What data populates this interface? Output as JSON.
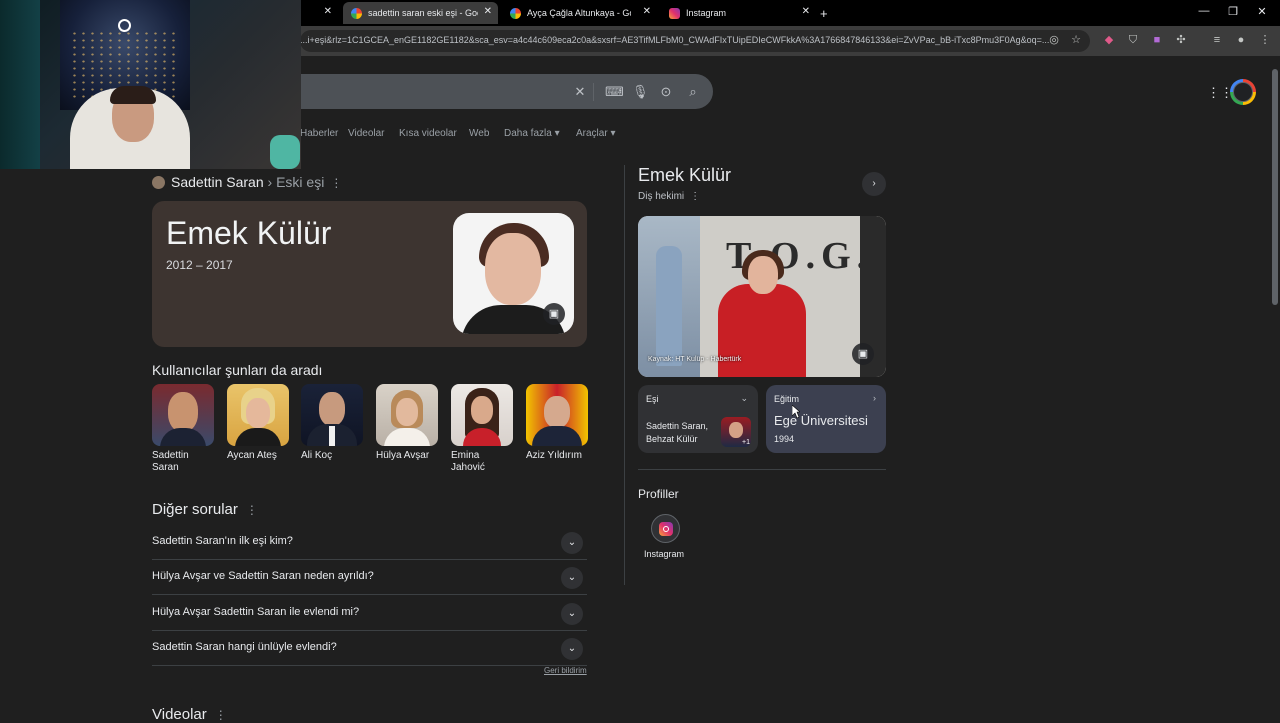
{
  "browser": {
    "tabs": [
      {
        "title": "sadettin saran eski eşi - Google",
        "active": true
      },
      {
        "title": "Ayça Çağla Altunkaya - Google",
        "active": false
      },
      {
        "title": "Instagram",
        "active": false
      }
    ],
    "url": "...i+eşi&rlz=1C1GCEA_enGE1182GE1182&sca_esv=a4c44c609eca2c0a&sxsrf=AE3TifMLFbM0_CWAdFIxTUipEDIeCWFkkA%3A1766847846133&ei=ZvVPac_bB-iTxc8Pmu3F0Ag&oq=...",
    "window_controls": [
      "—",
      "❐",
      "✕"
    ]
  },
  "search": {
    "nav_tabs": [
      "Haberler",
      "Videolar",
      "Kısa videolar",
      "Web",
      "Daha fazla ▾",
      "Araçlar ▾"
    ]
  },
  "main": {
    "breadcrumb": {
      "name": "Sadettin Saran",
      "separator": "›",
      "relation": "Eski eşi"
    },
    "hero": {
      "name": "Emek Külür",
      "years": "2012 – 2017"
    },
    "people_also_search": {
      "title": "Kullanıcılar şunları da aradı",
      "people": [
        {
          "name": "Sadettin Saran"
        },
        {
          "name": "Aycan Ateş"
        },
        {
          "name": "Ali Koç"
        },
        {
          "name": "Hülya Avşar"
        },
        {
          "name": "Emina Jahović"
        },
        {
          "name": "Aziz Yıldırım"
        }
      ]
    },
    "other_questions": {
      "title": "Diğer sorular",
      "questions": [
        "Sadettin Saran'ın ilk eşi kim?",
        "Hülya Avşar ve Sadettin Saran neden ayrıldı?",
        "Hülya Avşar Sadettin Saran ile evlendi mi?",
        "Sadettin Saran hangi ünlüyle evlendi?"
      ],
      "feedback": "Geri bildirim"
    },
    "videos_title": "Videolar"
  },
  "knowledge_panel": {
    "name": "Emek Külür",
    "subtitle": "Diş hekimi",
    "image_source": "Kaynak: HT Kulüp - Habertürk",
    "image_logo": "T.O.G.G.",
    "spouse": {
      "label": "Eşi",
      "value": "Sadettin Saran, Behzat Külür",
      "more": "+1"
    },
    "education": {
      "label": "Eğitim",
      "value": "Ege Üniversitesi",
      "year": "1994"
    },
    "profiles": {
      "title": "Profiller",
      "items": [
        {
          "label": "Instagram"
        }
      ]
    }
  }
}
